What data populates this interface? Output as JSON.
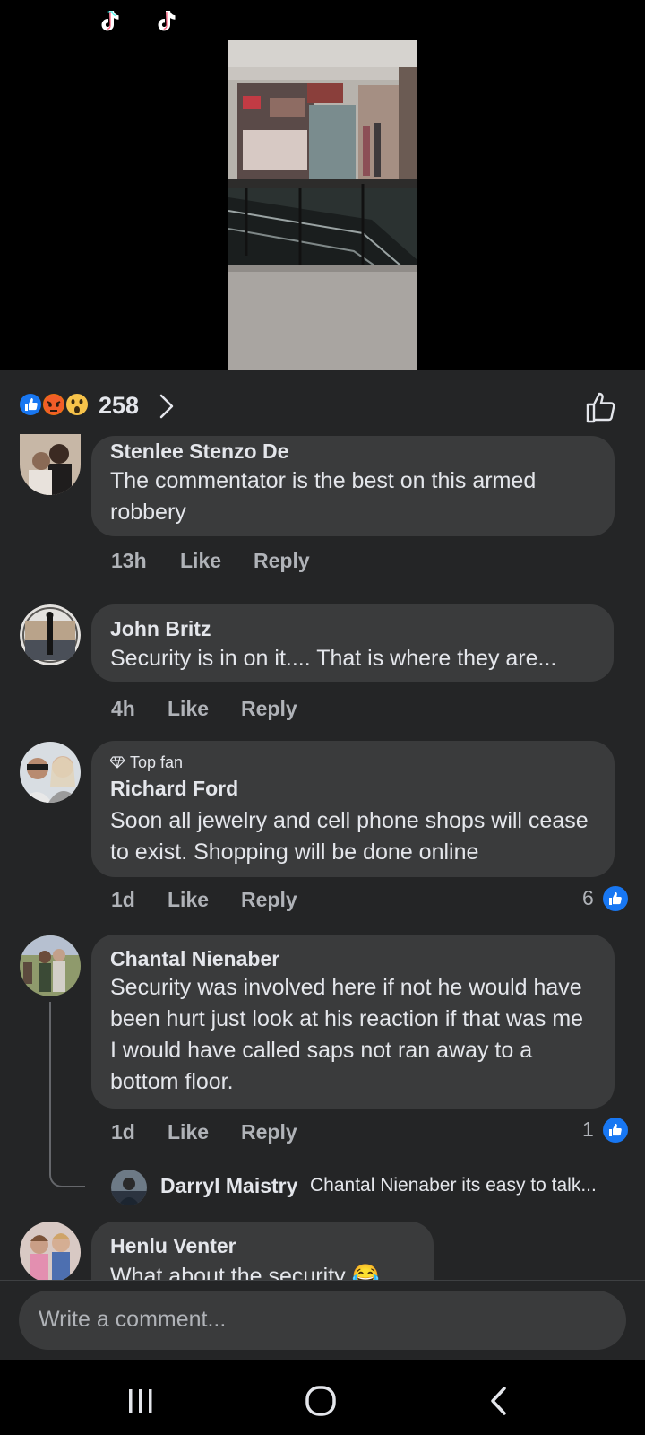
{
  "reactions": {
    "count": "258",
    "icons": [
      "like-icon",
      "angry-icon",
      "wow-icon"
    ]
  },
  "comments": [
    {
      "author": "Stenlee Stenzo De",
      "text": "The commentator is the best on this armed robbery",
      "time": "13h",
      "like_label": "Like",
      "reply_label": "Reply"
    },
    {
      "author": "John Britz",
      "text": "Security is in on it.... That is where they are...",
      "time": "4h",
      "like_label": "Like",
      "reply_label": "Reply"
    },
    {
      "badge": "Top fan",
      "author": "Richard Ford",
      "text": "Soon all jewelry and cell phone shops will cease to exist. Shopping will be done online",
      "time": "1d",
      "like_label": "Like",
      "reply_label": "Reply",
      "reaction_count": "6"
    },
    {
      "author": "Chantal Nienaber",
      "text": "Security was involved here if not he would have been hurt just look at his reaction if that was me I would have called saps not ran away to a bottom floor.",
      "time": "1d",
      "like_label": "Like",
      "reply_label": "Reply",
      "reaction_count": "1",
      "reply_preview": {
        "author": "Darryl Maistry",
        "text": "Chantal Nienaber its easy to talk..."
      }
    },
    {
      "author": "Henlu Venter",
      "text": "What about the security 😂"
    }
  ],
  "composer": {
    "placeholder": "Write a comment..."
  },
  "colors": {
    "background": "#242526",
    "bubble": "#3a3b3c",
    "text": "#e4e6eb",
    "secondary_text": "#b0b3b8",
    "like_blue": "#1877f2"
  }
}
